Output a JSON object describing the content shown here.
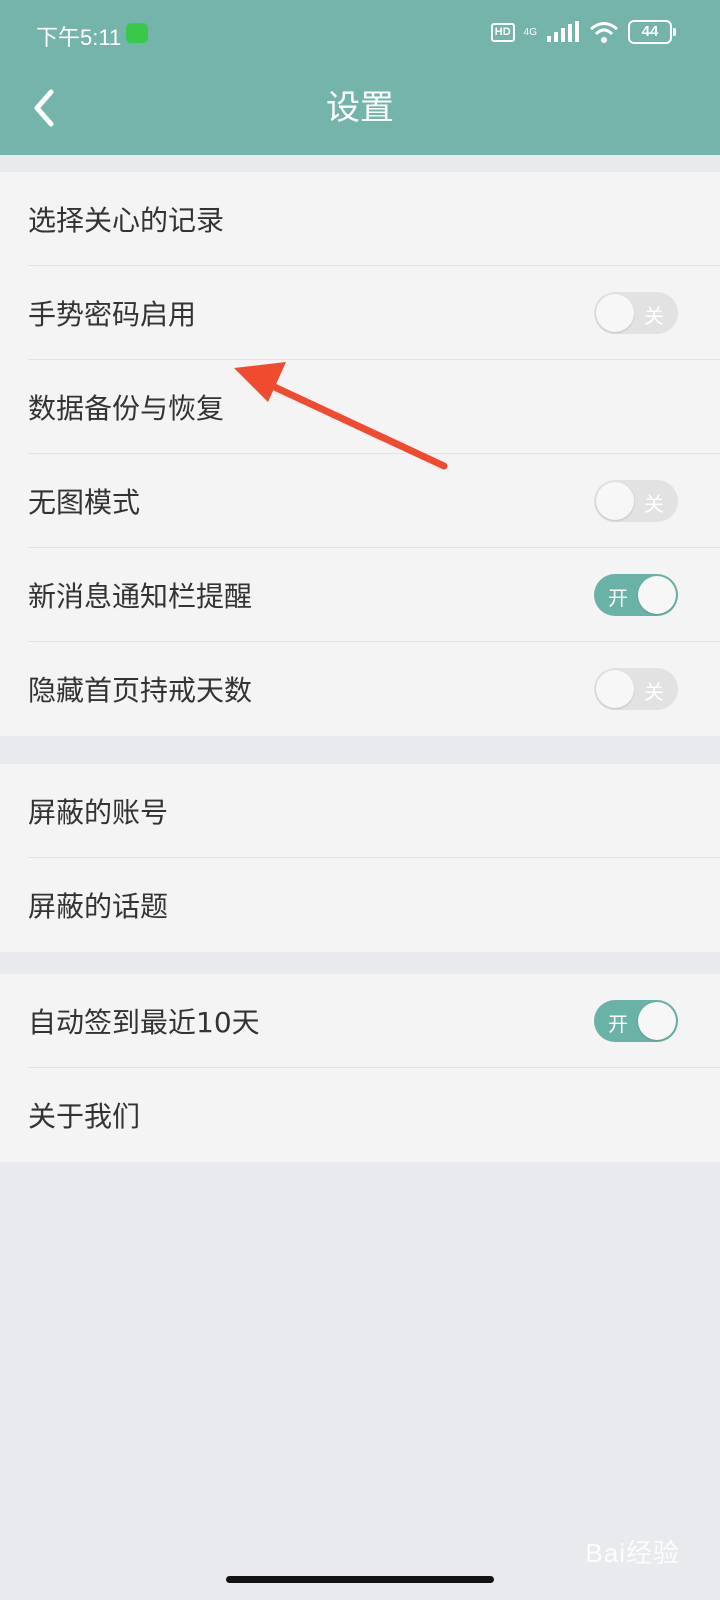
{
  "status_bar": {
    "time": "下午5:11",
    "hd": "HD",
    "network": "4G",
    "battery": "44"
  },
  "nav": {
    "title": "设置"
  },
  "groups": [
    {
      "items": [
        {
          "label": "选择关心的记录"
        },
        {
          "label": "手势密码启用",
          "toggle": "关"
        },
        {
          "label": "数据备份与恢复"
        },
        {
          "label": "无图模式",
          "toggle": "关"
        },
        {
          "label": "新消息通知栏提醒",
          "toggle": "开"
        },
        {
          "label": "隐藏首页持戒天数",
          "toggle": "关"
        }
      ]
    },
    {
      "items": [
        {
          "label": "屏蔽的账号"
        },
        {
          "label": "屏蔽的话题"
        }
      ]
    },
    {
      "items": [
        {
          "label": "自动签到最近10天",
          "toggle": "开"
        },
        {
          "label": "关于我们"
        }
      ]
    }
  ],
  "colors": {
    "header": "#74b4aa",
    "toggle_on": "#6ab2a7",
    "toggle_off": "#e2e2e2",
    "arrow": "#f04a2f"
  },
  "watermark": "Bai经验"
}
